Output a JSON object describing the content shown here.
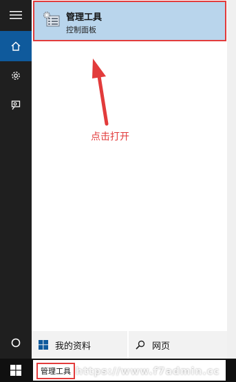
{
  "colors": {
    "accent": "#0f5a9c",
    "highlight": "#b9d5ec",
    "annotation": "#e23b3b"
  },
  "rail": {
    "items": [
      {
        "icon": "hamburger-icon"
      },
      {
        "icon": "home-icon"
      },
      {
        "icon": "settings-gear-icon"
      },
      {
        "icon": "feedback-person-icon"
      },
      {
        "icon": "power-icon"
      }
    ]
  },
  "result": {
    "title": "管理工具",
    "subtitle": "控制面板",
    "icon": "admin-tools-icon"
  },
  "annotation": {
    "text": "点击打开"
  },
  "bottom": {
    "my_stuff": "我的资料",
    "web": "网页"
  },
  "taskbar": {
    "query": "管理工具",
    "start_icon": "windows-logo-icon"
  },
  "watermark": "https://www.f7admin.cc"
}
